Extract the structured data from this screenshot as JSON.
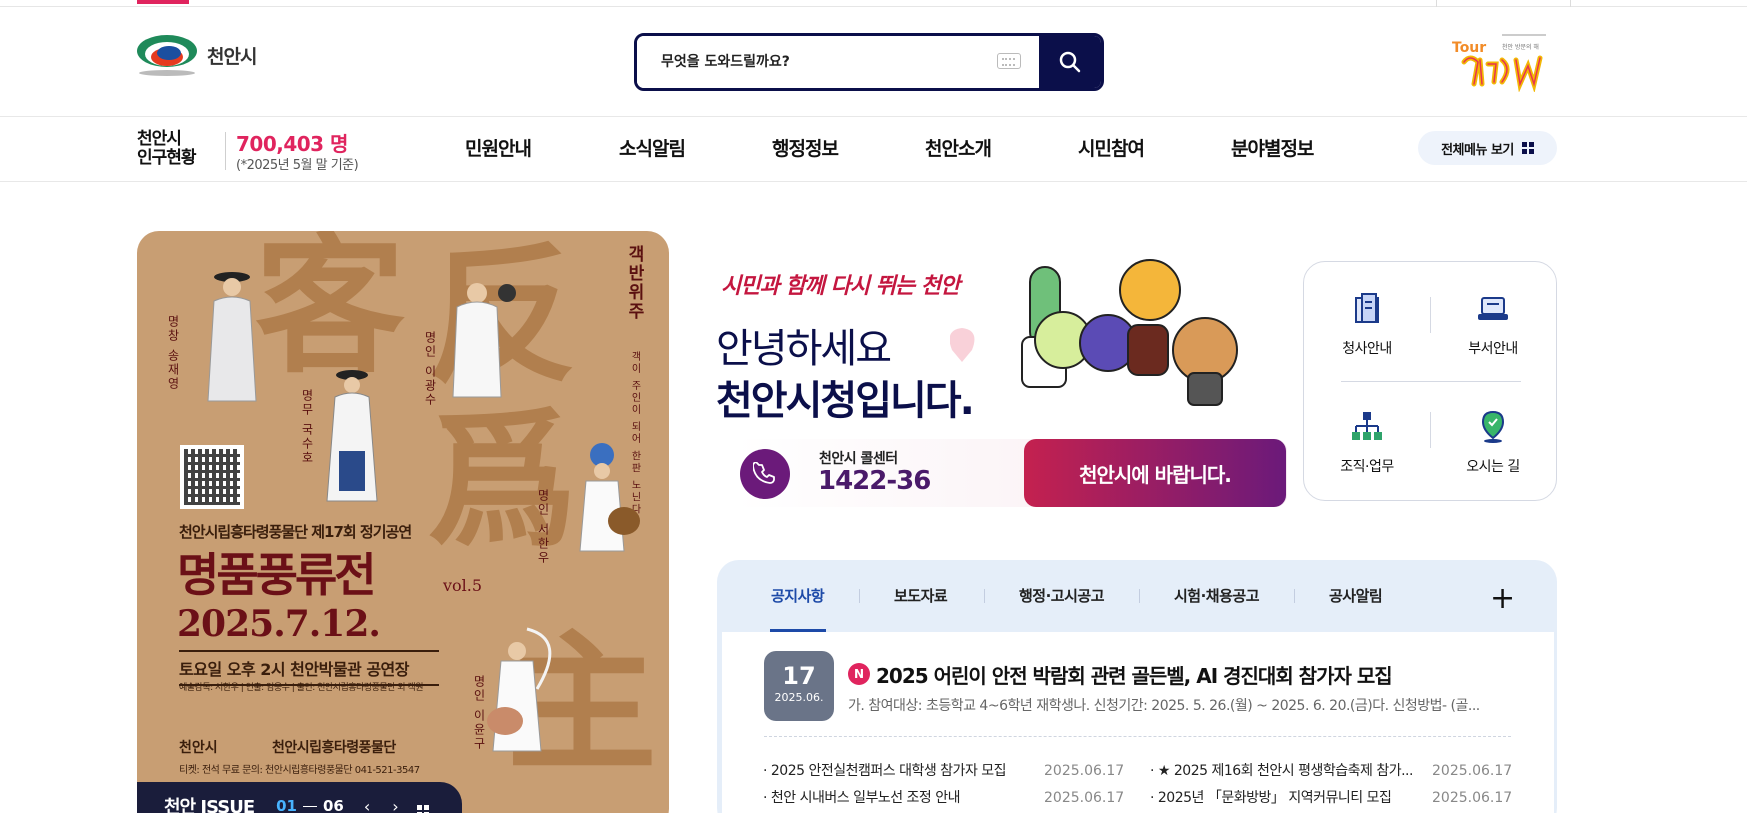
{
  "logo": {
    "name": "천안시"
  },
  "search": {
    "placeholder": "무엇을 도와드릴까요?"
  },
  "population": {
    "label_line1": "천안시",
    "label_line2": "인구현황",
    "value": "700,403 명",
    "note": "(*2025년 5월 말 기준)"
  },
  "nav": {
    "items": [
      "민원안내",
      "소식알림",
      "행정정보",
      "천안소개",
      "시민참여",
      "분야별정보"
    ],
    "all_menu": "전체메뉴 보기"
  },
  "poster": {
    "big_chars": [
      "客",
      "反",
      "爲",
      "主"
    ],
    "vertical_title": "객반위주",
    "vertical_sub": "객이 주인이 되어 한판 노닌다",
    "performers": [
      "명창 송재영",
      "명무 국수호",
      "명인 이광수",
      "명인 서한우",
      "명인 이윤구"
    ],
    "subtitle": "천안시립흥타령풍물단 제17회 정기공연",
    "title": "명품풍류전",
    "vol": "vol.5",
    "date": "2025.7.12.",
    "time_place": "토요일 오후 2시 천안박물관 공연장",
    "credits": "예술감독: 서한우 | 연출: 임웅수 | 출연: 천안시립흥타령풍물단 외 객원",
    "org1": "천안시",
    "org2": "천안시립흥타령풍물단",
    "ticket": "티켓: 전석 무료   문의: 천안시립흥타령풍물단 041-521-3547"
  },
  "issue": {
    "label": "천안 ISSUE",
    "current": "01",
    "total": "06"
  },
  "greeting": {
    "slogan": "시민과 함께 다시 뛰는 천안",
    "line1": "안녕하세요",
    "line2": "천안시청입니다."
  },
  "call_center": {
    "label": "천안시 콜센터",
    "number": "1422-36"
  },
  "petition_button": "천안시에 바랍니다.",
  "quick_links": [
    "청사안내",
    "부서안내",
    "조직·업무",
    "오시는 길"
  ],
  "notice": {
    "tabs": [
      "공지사항",
      "보도자료",
      "행정·고시공고",
      "시험·채용공고",
      "공사알림"
    ],
    "featured": {
      "day": "17",
      "year_month": "2025.06.",
      "badge": "N",
      "title": "2025 어린이 안전 박람회 관련 골든벨, AI 경진대회 참가자 모집",
      "summary": "가. 참여대상: 초등학교 4~6학년 재학생나. 신청기간: 2025. 5. 26.(월) ~ 2025. 6. 20.(금)다. 신청방법- (골..."
    },
    "list": [
      {
        "title": "· 2025 안전실천캠퍼스 대학생 참가자 모집",
        "date": "2025.06.17"
      },
      {
        "title": "· ★ 2025 제16회 천안시 평생학습축제 참가...",
        "date": "2025.06.17"
      },
      {
        "title": "· 천안 시내버스 일부노선 조정 안내",
        "date": "2025.06.17"
      },
      {
        "title": "· 2025년 「문화방방」 지역커뮤니티 모집",
        "date": "2025.06.17"
      }
    ]
  },
  "colors": {
    "navy": "#0b0f4a",
    "accent_pink": "#e0245e",
    "poster_bg": "#c89e73",
    "purple": "#6b1a7a",
    "notice_bg": "#e5eef9"
  }
}
